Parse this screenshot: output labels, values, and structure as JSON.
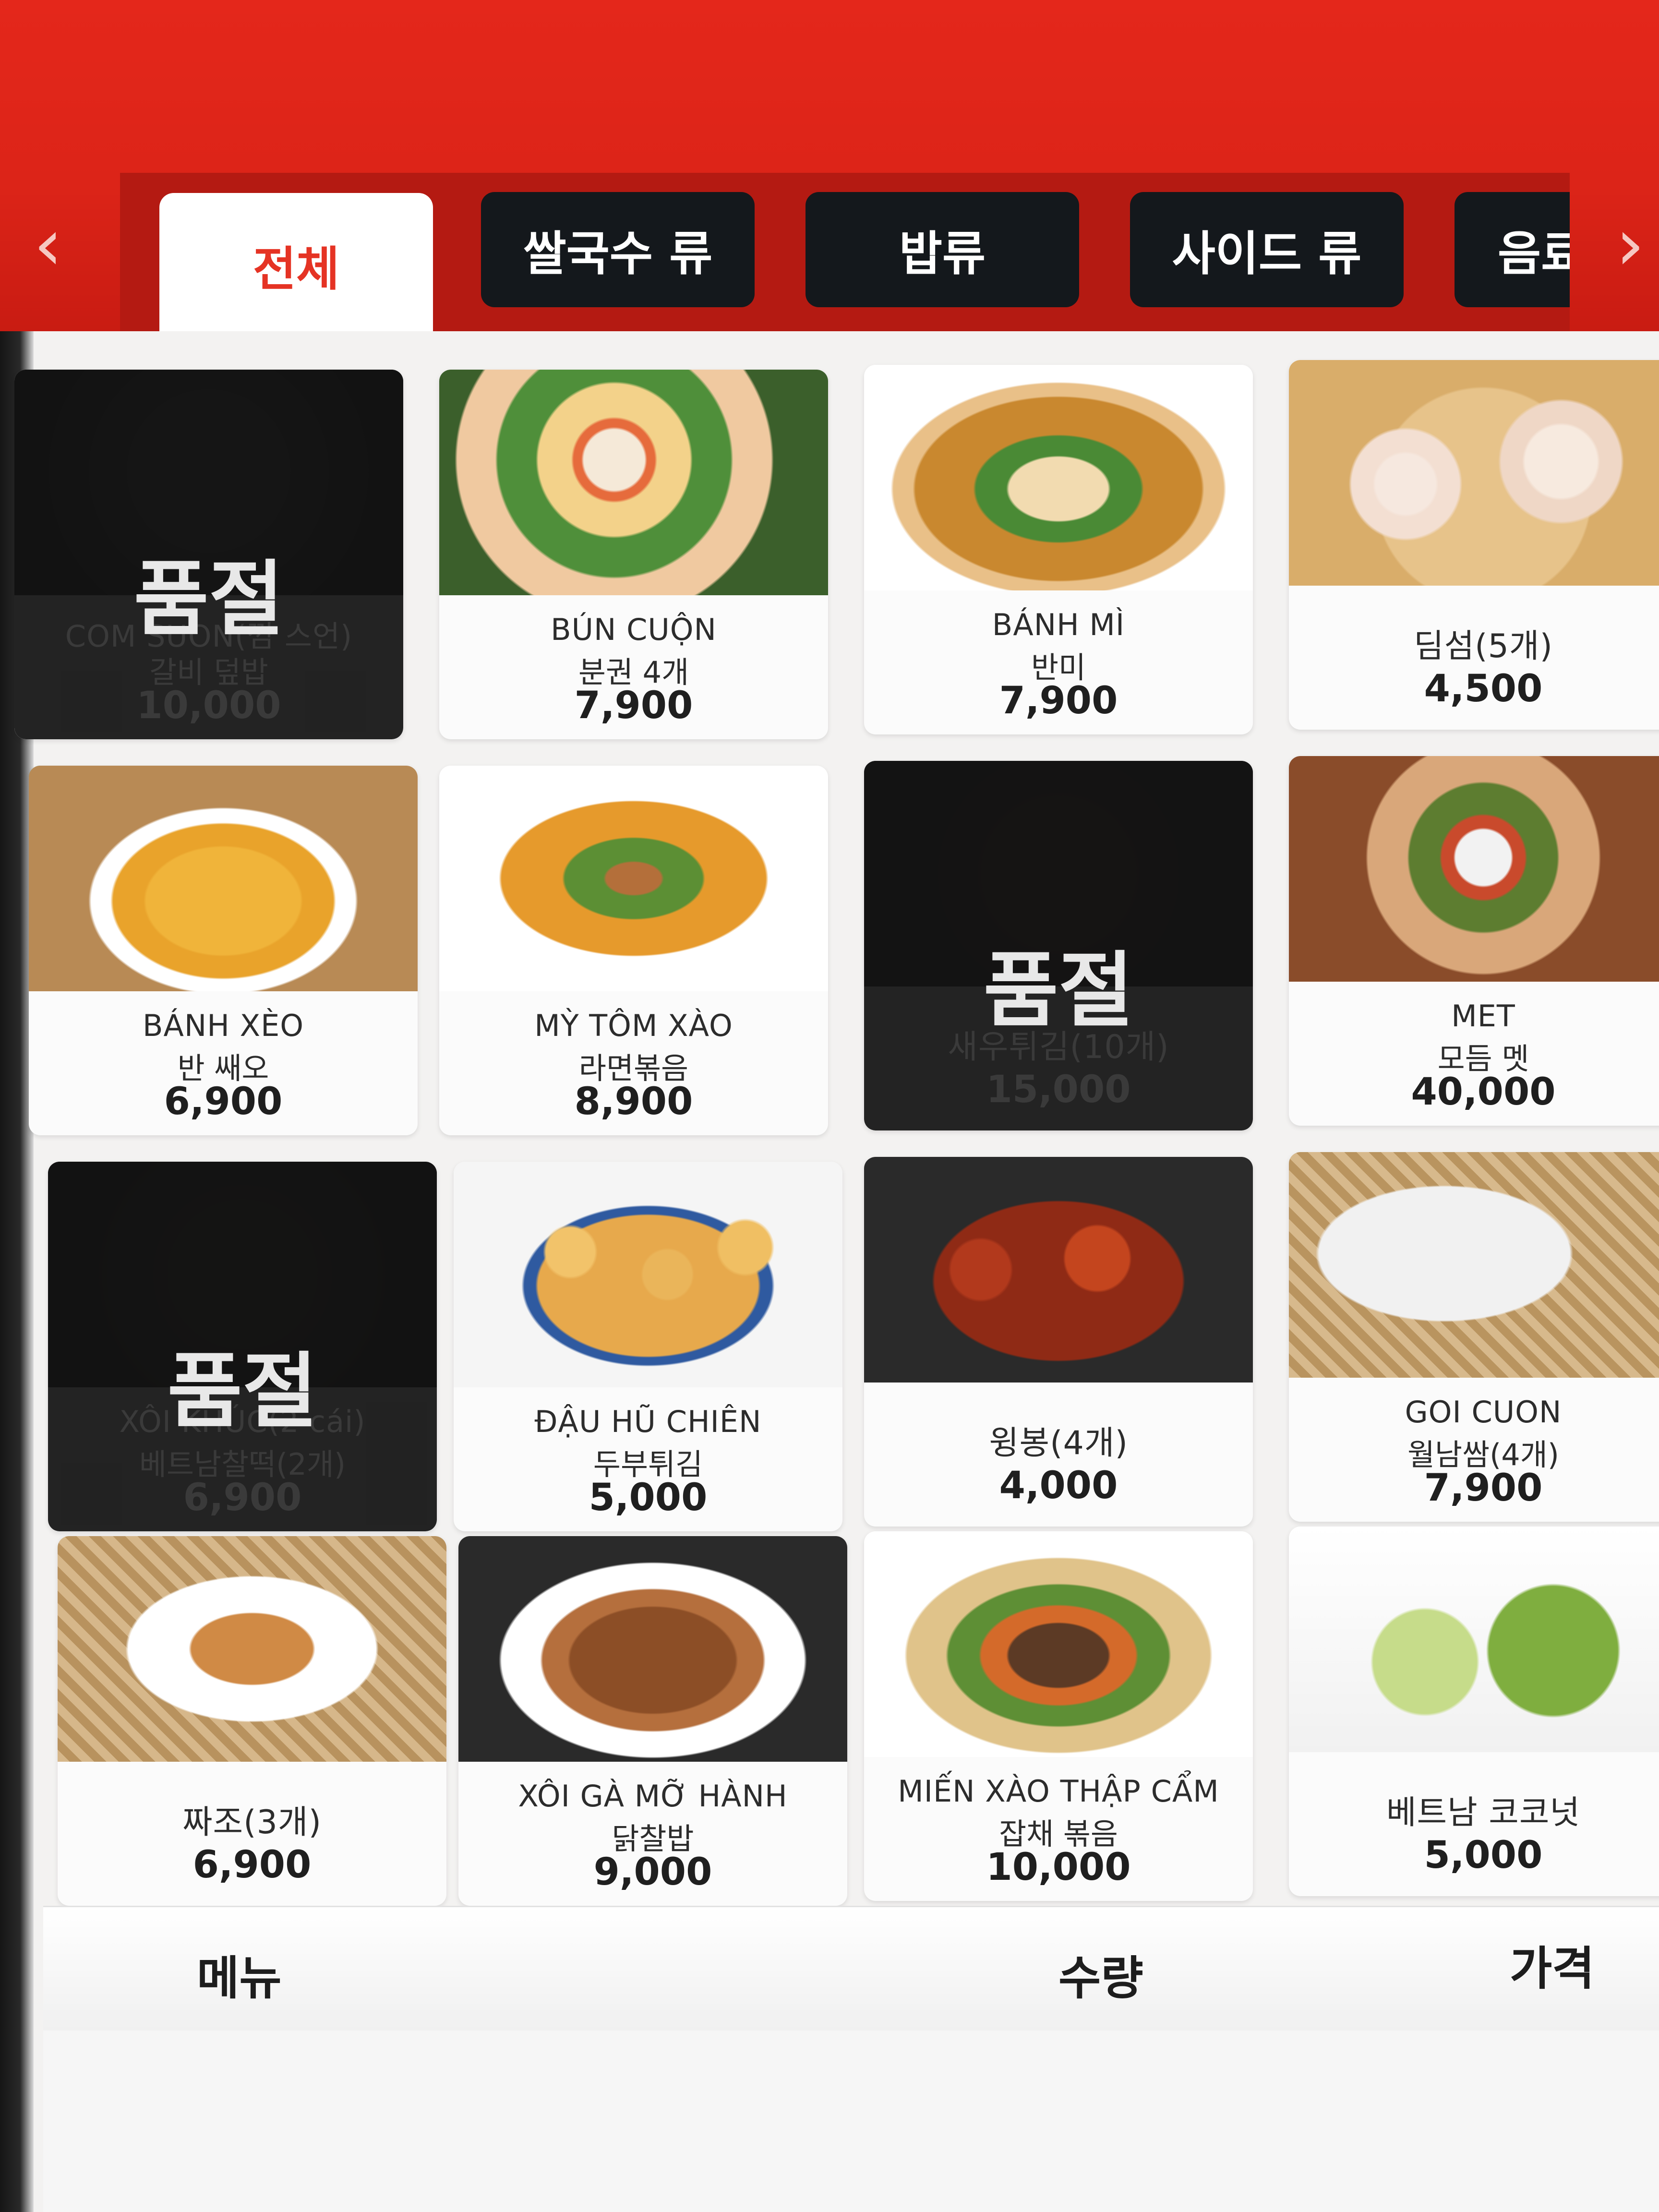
{
  "nav": {
    "prev_arrow": "‹",
    "next_arrow": "›",
    "tabs": [
      "전체",
      "쌀국수 류",
      "밥류",
      "사이드 류",
      "음료"
    ],
    "active_tab": "전체"
  },
  "soldout_label": "품절",
  "menu": [
    {
      "name1": "COM SUON(껌 스언)",
      "name2": "갈비 덮밥",
      "price": "10,000",
      "soldout": true
    },
    {
      "name1": "BÚN CUỘN",
      "name2": "분권 4개",
      "price": "7,900",
      "soldout": false
    },
    {
      "name1": "BÁNH MÌ",
      "name2": "반미",
      "price": "7,900",
      "soldout": false
    },
    {
      "name1": "딤섬(5개)",
      "name2": "",
      "price": "4,500",
      "soldout": false
    },
    {
      "name1": "BÁNH XÈO",
      "name2": "반 쌔오",
      "price": "6,900",
      "soldout": false
    },
    {
      "name1": "MỲ TÔM XÀO",
      "name2": "라면볶음",
      "price": "8,900",
      "soldout": false
    },
    {
      "name1": "새우튀김(10개)",
      "name2": "",
      "price": "15,000",
      "soldout": true
    },
    {
      "name1": "MET",
      "name2": "모듬 멧",
      "price": "40,000",
      "soldout": false
    },
    {
      "name1": "XÔI KHÚC(2 cái)",
      "name2": "베트남찰떡(2개)",
      "price": "6,900",
      "soldout": true
    },
    {
      "name1": "ĐẬU HŨ CHIÊN",
      "name2": "두부튀김",
      "price": "5,000",
      "soldout": false
    },
    {
      "name1": "윙봉(4개)",
      "name2": "",
      "price": "4,000",
      "soldout": false
    },
    {
      "name1": "GOI CUON",
      "name2": "월남쌈(4개)",
      "price": "7,900",
      "soldout": false
    },
    {
      "name1": "짜조(3개)",
      "name2": "",
      "price": "6,900",
      "soldout": false
    },
    {
      "name1": "XÔI GÀ MỠ HÀNH",
      "name2": "닭찰밥",
      "price": "9,000",
      "soldout": false
    },
    {
      "name1": "MIẾN XÀO THẬP CẨM",
      "name2": "잡채 볶음",
      "price": "10,000",
      "soldout": false
    },
    {
      "name1": "베트남 코코넛",
      "name2": "",
      "price": "5,000",
      "soldout": false
    }
  ],
  "footer": {
    "menu_label": "메뉴",
    "quantity_label": "수량",
    "price_label": "가격"
  },
  "colors": {
    "header_red": "#dc2418",
    "active_tab_text": "#e53324",
    "tab_dark": "#14181c"
  }
}
